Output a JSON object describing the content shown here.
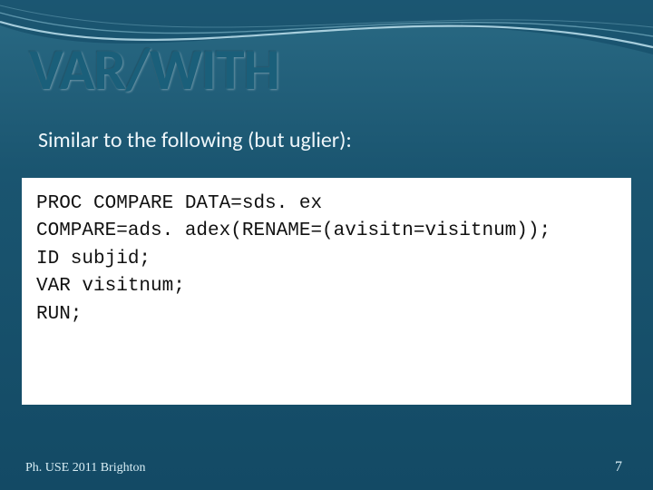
{
  "slide": {
    "title": "VAR/WITH",
    "subtitle": "Similar to the following (but uglier):",
    "code": "PROC COMPARE DATA=sds. ex\nCOMPARE=ads. adex(RENAME=(avisitn=visitnum));\nID subjid;\nVAR visitnum;\nRUN;",
    "footer_left": "Ph. USE 2011 Brighton",
    "page_number": "7"
  }
}
